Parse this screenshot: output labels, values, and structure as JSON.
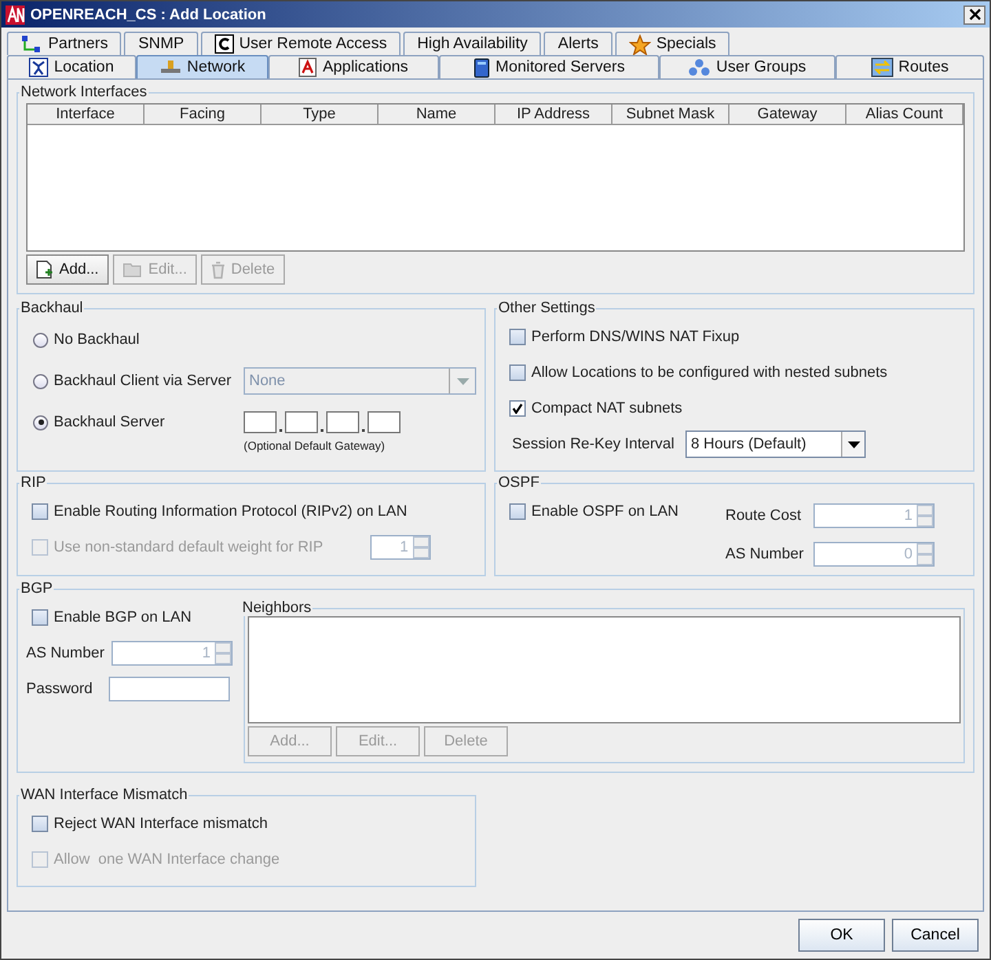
{
  "window": {
    "title": "OPENREACH_CS : Add Location"
  },
  "tabs_row_1": [
    {
      "label": "Partners",
      "selected": false
    },
    {
      "label": "SNMP",
      "selected": false
    },
    {
      "label": "User Remote Access",
      "selected": false
    },
    {
      "label": "High Availability",
      "selected": false
    },
    {
      "label": "Alerts",
      "selected": false
    },
    {
      "label": "Specials",
      "selected": false
    }
  ],
  "tabs_row_2": [
    {
      "label": "Location",
      "selected": false
    },
    {
      "label": "Network",
      "selected": true
    },
    {
      "label": "Applications",
      "selected": false
    },
    {
      "label": "Monitored Servers",
      "selected": false
    },
    {
      "label": "User Groups",
      "selected": false
    },
    {
      "label": "Routes",
      "selected": false
    }
  ],
  "network_interfaces": {
    "title": "Network Interfaces",
    "columns": [
      "Interface",
      "Facing",
      "Type",
      "Name",
      "IP Address",
      "Subnet Mask",
      "Gateway",
      "Alias Count"
    ],
    "buttons": [
      {
        "label": "Add...",
        "disabled": false
      },
      {
        "label": "Edit...",
        "disabled": true
      },
      {
        "label": "Delete",
        "disabled": true
      }
    ]
  },
  "backhaul": {
    "title": "Backhaul",
    "options": [
      {
        "kind": "plain",
        "label": "No Backhaul",
        "selected": false
      },
      {
        "kind": "select",
        "label": "Backhaul Client via Server",
        "selected": false
      },
      {
        "kind": "ip",
        "label": "Backhaul Server",
        "selected": true
      }
    ],
    "server_select": {
      "value": "None",
      "disabled": true
    },
    "gateway_hint": "(Optional Default Gateway)"
  },
  "other_settings": {
    "title": "Other Settings",
    "checkboxes": [
      {
        "label": "Perform DNS/WINS NAT Fixup",
        "checked": false
      },
      {
        "label": "Allow Locations to be configured with nested subnets",
        "checked": false
      },
      {
        "label": "Compact NAT subnets",
        "checked": true
      }
    ],
    "rekey": {
      "label": "Session Re-Key Interval",
      "value": "8 Hours (Default)"
    }
  },
  "rip": {
    "title": "RIP",
    "checkboxes": [
      {
        "label": "Enable Routing Information Protocol (RIPv2) on LAN",
        "checked": false,
        "disabled": false
      },
      {
        "label": "Use non-standard default weight for RIP",
        "checked": false,
        "disabled": true
      }
    ],
    "weight": {
      "value": "1",
      "disabled": true
    }
  },
  "ospf": {
    "title": "OSPF",
    "enable": {
      "label": "Enable OSPF on LAN",
      "checked": false
    },
    "fields": [
      {
        "label": "Route Cost",
        "value": "1",
        "disabled": true
      },
      {
        "label": "AS Number",
        "value": "0",
        "disabled": true
      }
    ]
  },
  "bgp": {
    "title": "BGP",
    "enable": {
      "label": "Enable BGP on LAN",
      "checked": false
    },
    "as_number": {
      "label": "AS Number",
      "value": "1",
      "disabled": true
    },
    "password": {
      "label": "Password"
    },
    "neighbors": {
      "title": "Neighbors",
      "buttons": [
        {
          "label": "Add...",
          "disabled": true
        },
        {
          "label": "Edit...",
          "disabled": true
        },
        {
          "label": "Delete",
          "disabled": true
        }
      ]
    }
  },
  "wan_mismatch": {
    "title": "WAN Interface Mismatch",
    "checkboxes": [
      {
        "label": "Reject WAN Interface mismatch",
        "checked": false,
        "disabled": false
      },
      {
        "label": "Allow  one WAN Interface change",
        "checked": false,
        "disabled": true
      }
    ]
  },
  "buttons": [
    {
      "label": "OK"
    },
    {
      "label": "Cancel"
    }
  ]
}
